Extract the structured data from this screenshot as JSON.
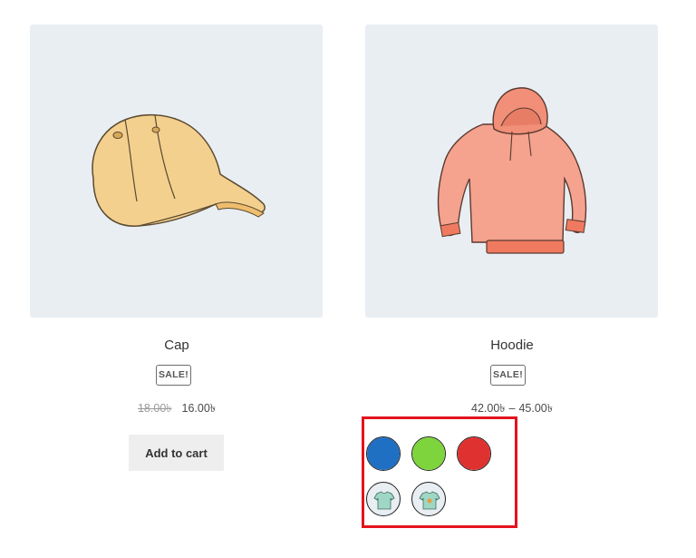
{
  "products": [
    {
      "name": "Cap",
      "badge": "SALE!",
      "price_regular": "18.00৳",
      "price_sale": "16.00৳",
      "button_label": "Add to cart",
      "image_icon": "cap-image"
    },
    {
      "name": "Hoodie",
      "badge": "SALE!",
      "price_min": "42.00৳",
      "price_sep": "–",
      "price_max": "45.00৳",
      "image_icon": "hoodie-image",
      "swatches": [
        {
          "label": "blue",
          "color": "#1f6fc3"
        },
        {
          "label": "green",
          "color": "#7ed43c"
        },
        {
          "label": "red",
          "color": "#e03131"
        },
        {
          "label": "tshirt-variant-1",
          "icon": "tshirt-thumbnail-icon"
        },
        {
          "label": "tshirt-variant-2",
          "icon": "tshirt-thumbnail-icon"
        }
      ]
    }
  ],
  "colors": {
    "image_bg": "#e9eef3",
    "highlight_border": "#e3131d",
    "button_bg": "#eeeeee"
  }
}
